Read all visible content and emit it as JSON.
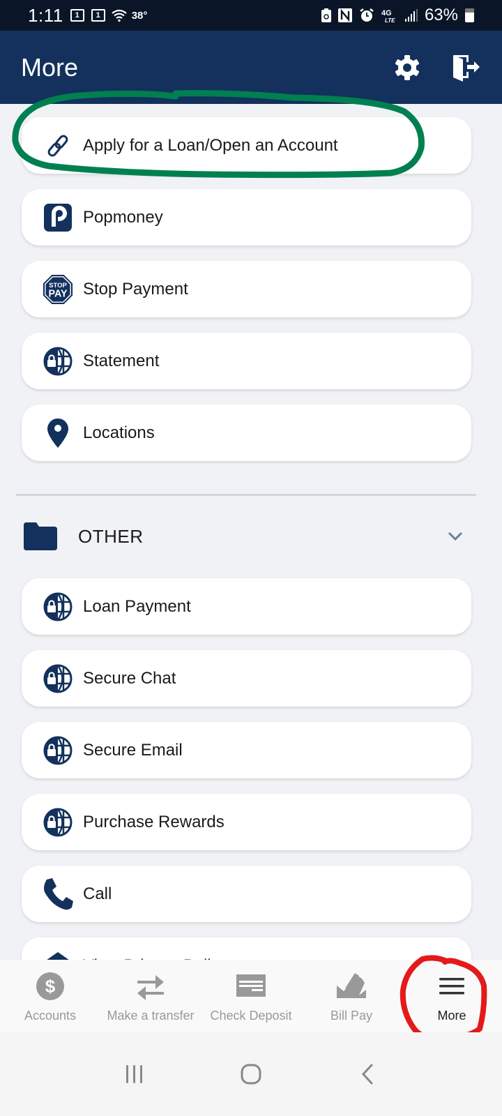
{
  "status_bar": {
    "time": "1:11",
    "notif_badge_1": "1",
    "notif_badge_2": "1",
    "temperature": "38°",
    "network": "4G LTE",
    "battery_percent": "63%"
  },
  "header": {
    "title": "More",
    "settings_icon": "gear-icon",
    "logout_icon": "door-exit-icon"
  },
  "main_items": [
    {
      "label": "Apply for a Loan/Open an Account",
      "icon": "link-icon"
    },
    {
      "label": "Popmoney",
      "icon": "popmoney-icon"
    },
    {
      "label": "Stop Payment",
      "icon": "stop-pay-icon"
    },
    {
      "label": "Statement",
      "icon": "secure-globe-icon"
    },
    {
      "label": "Locations",
      "icon": "map-pin-icon"
    }
  ],
  "section": {
    "title": "OTHER",
    "icon": "folder-icon",
    "expanded": true
  },
  "other_items": [
    {
      "label": "Loan Payment",
      "icon": "secure-globe-icon"
    },
    {
      "label": "Secure Chat",
      "icon": "secure-globe-icon"
    },
    {
      "label": "Secure Email",
      "icon": "secure-globe-icon"
    },
    {
      "label": "Purchase Rewards",
      "icon": "secure-globe-icon"
    },
    {
      "label": "Call",
      "icon": "phone-icon"
    },
    {
      "label": "View Privacy Policy",
      "icon": "shield-home-icon"
    }
  ],
  "bottom_nav": [
    {
      "label": "Accounts",
      "icon": "dollar-circle-icon",
      "active": false
    },
    {
      "label": "Make a transfer",
      "icon": "transfer-arrows-icon",
      "active": false
    },
    {
      "label": "Check Deposit",
      "icon": "check-icon",
      "active": false
    },
    {
      "label": "Bill Pay",
      "icon": "bill-envelope-icon",
      "active": false
    },
    {
      "label": "More",
      "icon": "hamburger-icon",
      "active": true
    }
  ],
  "colors": {
    "brand_navy": "#13315c",
    "status_bar": "#0a1628",
    "background": "#f0f2f6",
    "annotation_green": "#008050",
    "annotation_red": "#e41a1a"
  }
}
